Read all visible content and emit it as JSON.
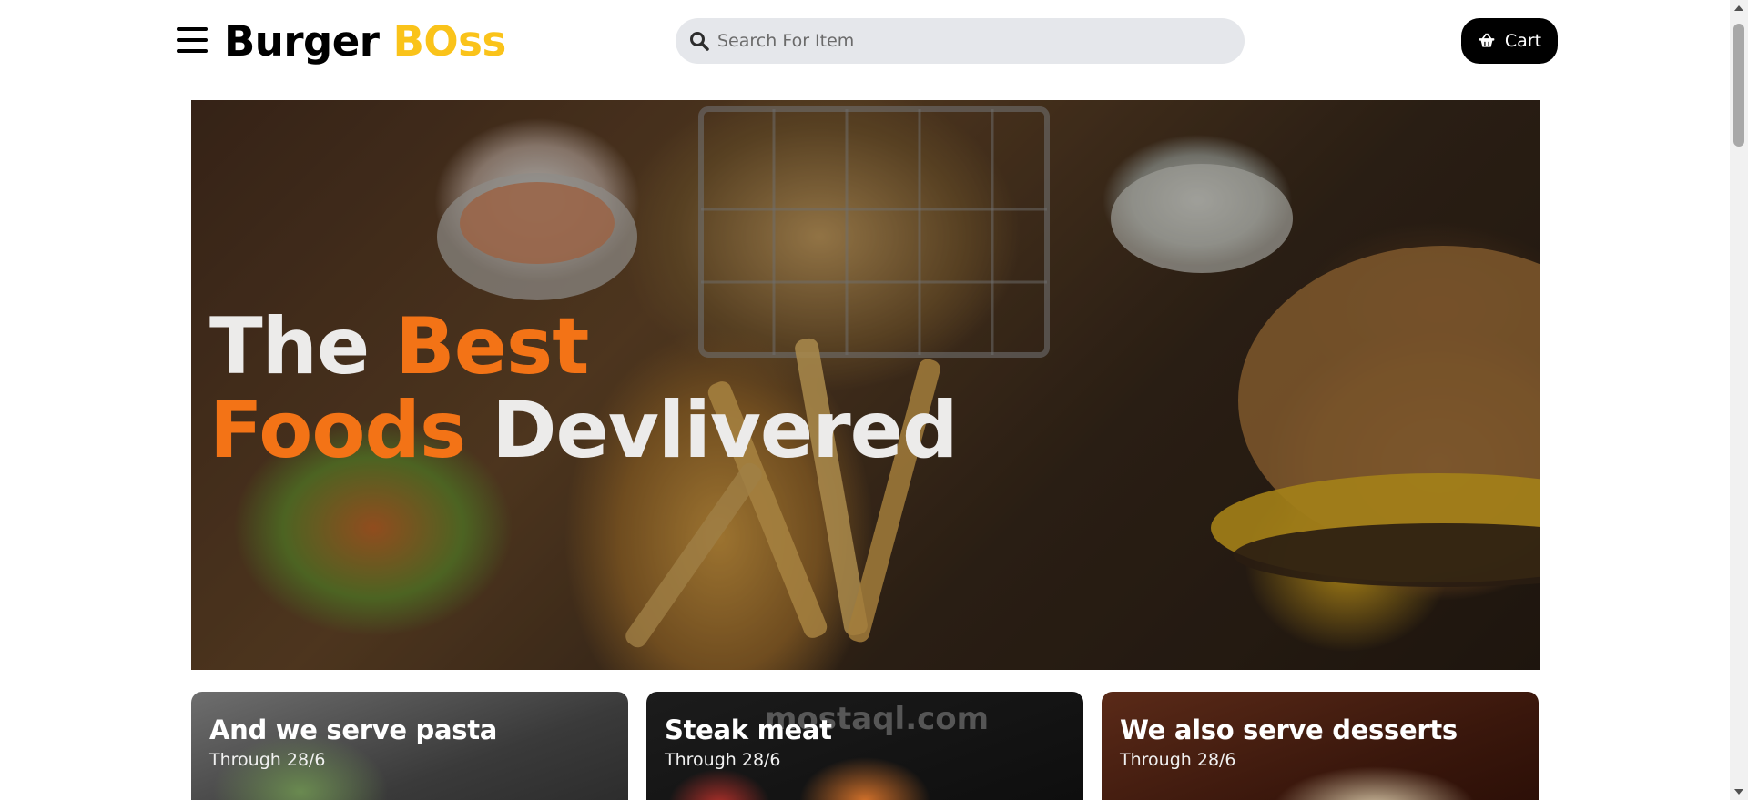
{
  "header": {
    "brand_part1": "Burger",
    "brand_part2": "BOss",
    "search_placeholder": "Search For Item",
    "cart_label": "Cart"
  },
  "hero": {
    "line1_white": "The",
    "line1_orange": "Best",
    "line2_orange": "Foods",
    "line2_white": "Devlivered"
  },
  "promos": [
    {
      "title": "And we serve pasta",
      "subtitle": "Through 28/6"
    },
    {
      "title": "Steak meat",
      "subtitle": "Through 28/6"
    },
    {
      "title": "We also serve desserts",
      "subtitle": "Through 28/6"
    }
  ],
  "watermark": "mostaql.com",
  "icons": {
    "menu": "hamburger-menu-icon",
    "search": "search-icon",
    "cart": "basket-icon"
  },
  "colors": {
    "brand_accent": "#fac31a",
    "hero_accent": "#f37316",
    "search_bg": "#e5e7eb",
    "cart_bg": "#000000"
  }
}
